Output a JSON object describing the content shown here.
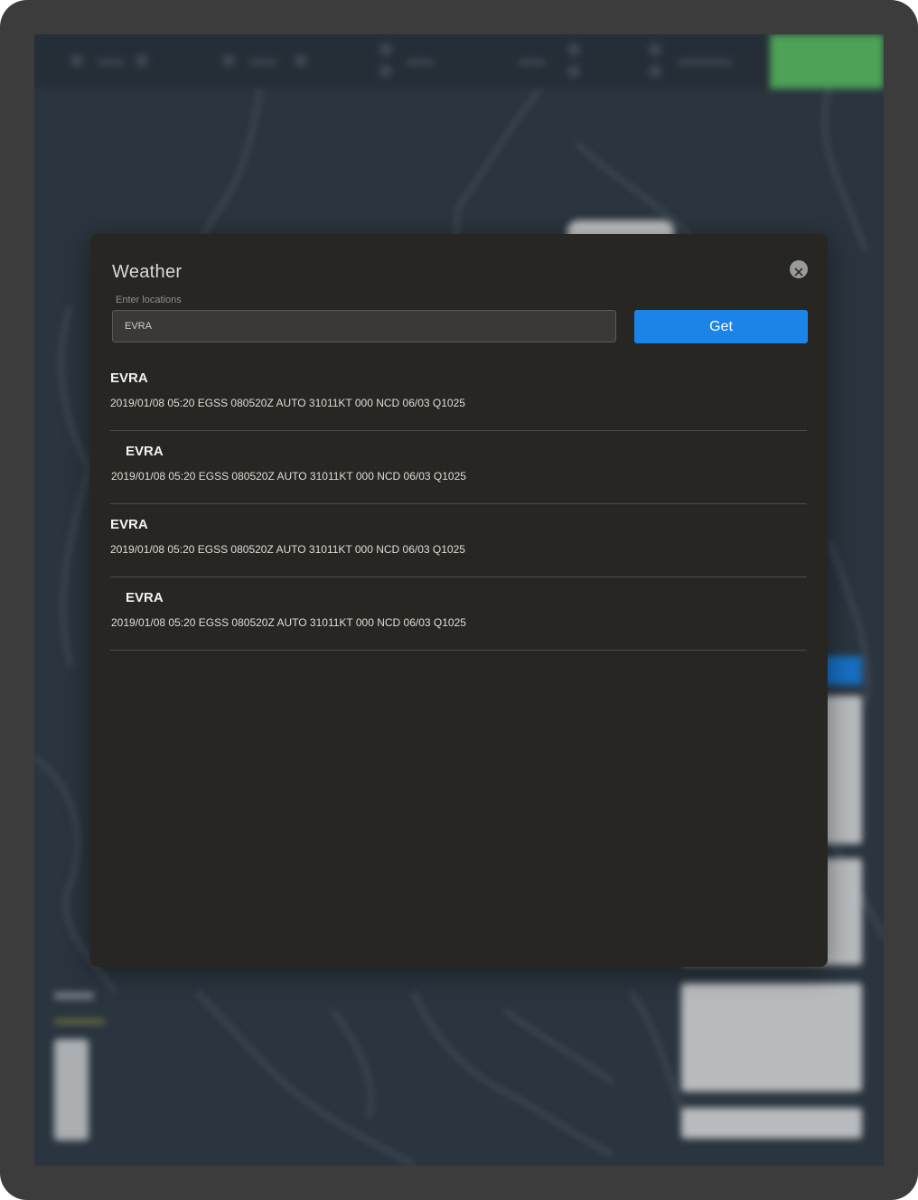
{
  "modal": {
    "title": "Weather",
    "close_icon": "close-icon",
    "input_label": "Enter locations",
    "input_value": "EVRA",
    "get_button_label": "Get"
  },
  "results": [
    {
      "station": "EVRA",
      "report": "2019/01/08 05:20 EGSS 080520Z AUTO 31011KT 000 NCD 06/03 Q1025"
    },
    {
      "station": "EVRA",
      "report": "2019/01/08 05:20 EGSS 080520Z AUTO 31011KT 000 NCD 06/03 Q1025"
    },
    {
      "station": "EVRA",
      "report": "2019/01/08 05:20 EGSS 080520Z AUTO 31011KT 000 NCD 06/03 Q1025"
    },
    {
      "station": "EVRA",
      "report": "2019/01/08 05:20 EGSS 080520Z AUTO 31011KT 000 NCD 06/03 Q1025"
    }
  ],
  "colors": {
    "accent": "#1a84e8",
    "modal_bg": "#272623",
    "map_bg": "#323d4a",
    "go_button": "#5cc266"
  }
}
